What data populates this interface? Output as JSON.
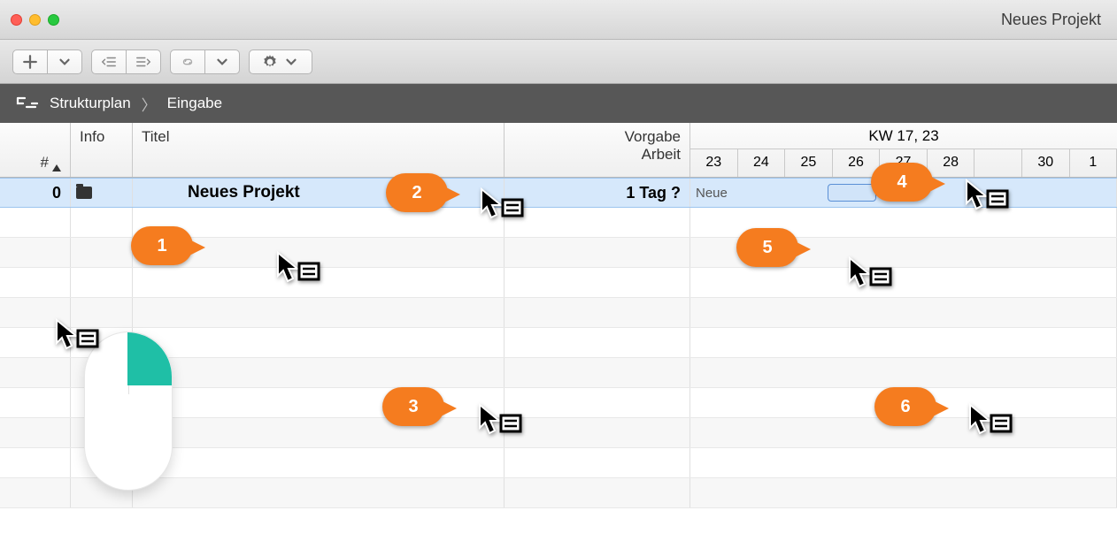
{
  "window": {
    "title": "Neues Projekt"
  },
  "breadcrumb": {
    "item1": "Strukturplan",
    "item2": "Eingabe"
  },
  "columns": {
    "num": "#",
    "info": "Info",
    "title": "Titel",
    "vorgabe_line1": "Vorgabe",
    "vorgabe_line2": "Arbeit"
  },
  "gantt": {
    "week_label": "KW 17, 23",
    "days": [
      "23",
      "24",
      "25",
      "26",
      "27",
      "28",
      "",
      "30",
      "1"
    ]
  },
  "row": {
    "num": "0",
    "title": "Neues Projekt",
    "vorgabe": "1 Tag ?",
    "gantt_label": "Neue"
  },
  "callouts": {
    "c1": "1",
    "c2": "2",
    "c3": "3",
    "c4": "4",
    "c5": "5",
    "c6": "6"
  }
}
